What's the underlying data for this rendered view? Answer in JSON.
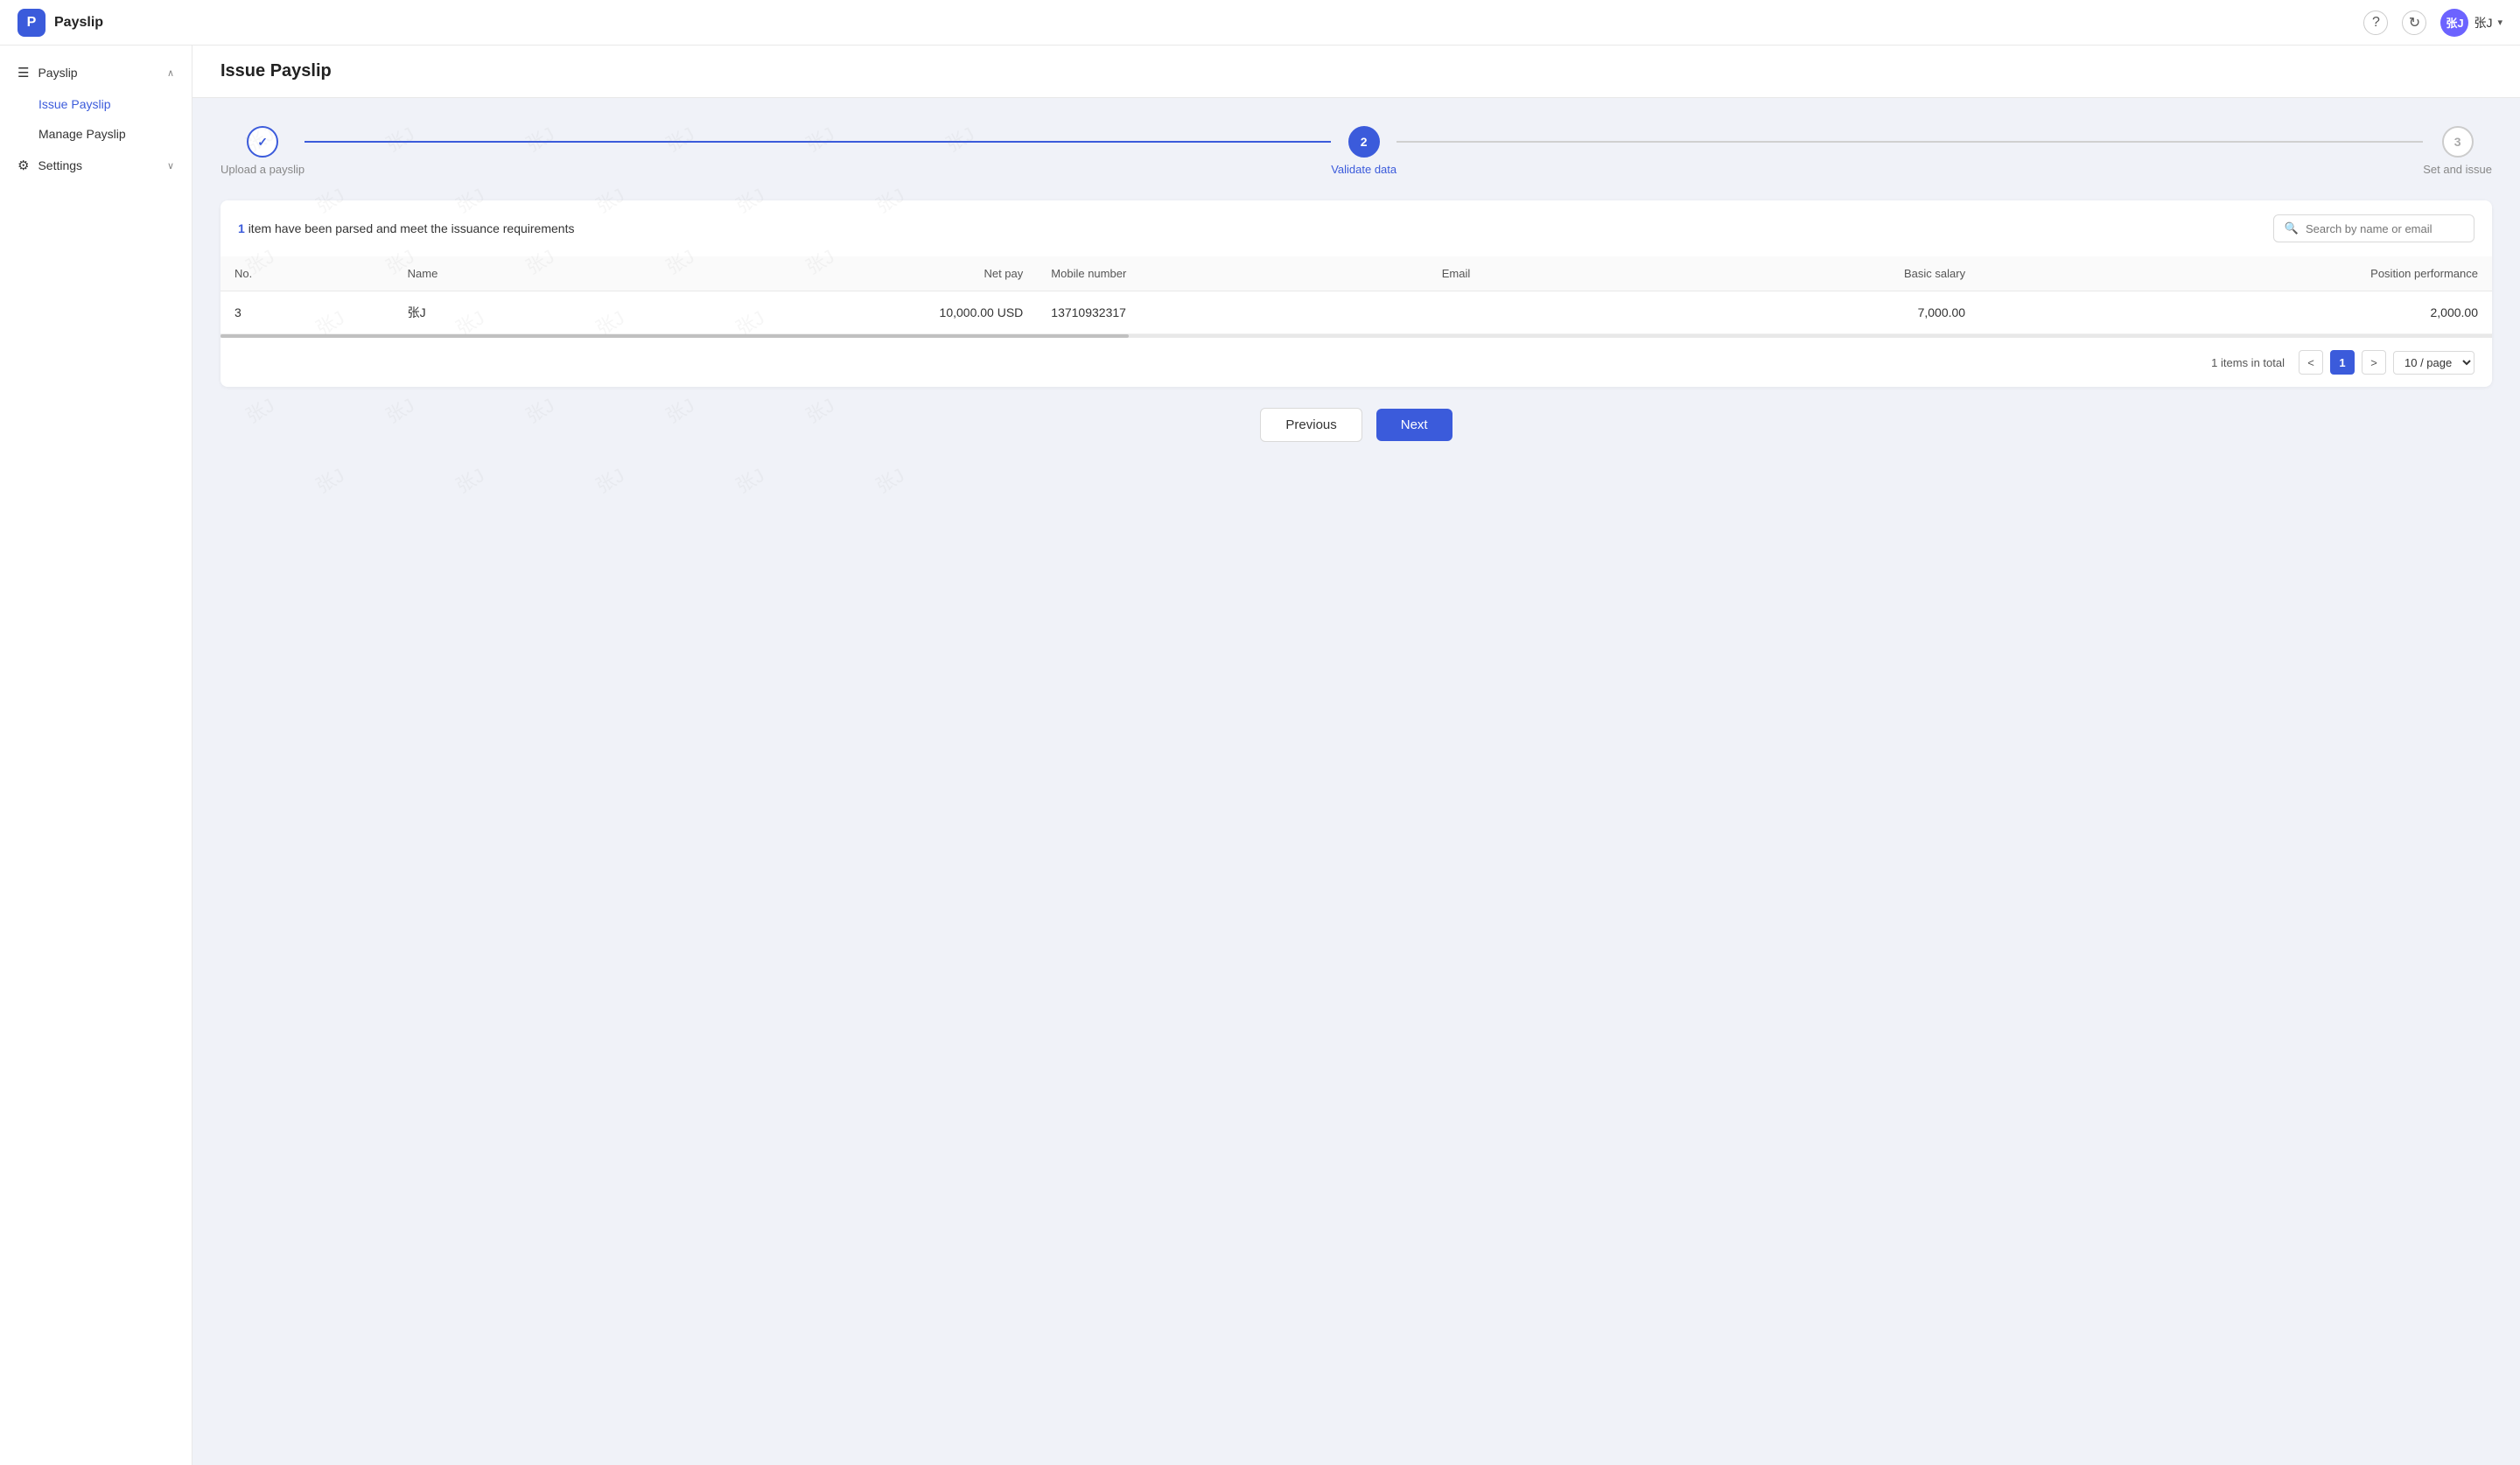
{
  "app": {
    "logo_letter": "P",
    "title": "Payslip"
  },
  "topbar": {
    "help_icon": "?",
    "refresh_icon": "↻",
    "user_avatar": "张J",
    "user_name": "张J",
    "chevron": "▾"
  },
  "sidebar": {
    "payslip_label": "Payslip",
    "issue_payslip_label": "Issue Payslip",
    "manage_payslip_label": "Manage Payslip",
    "settings_label": "Settings"
  },
  "page": {
    "title": "Issue Payslip"
  },
  "steps": [
    {
      "id": 1,
      "label": "Upload a payslip",
      "state": "done",
      "symbol": "✓"
    },
    {
      "id": 2,
      "label": "Validate data",
      "state": "active",
      "symbol": "2"
    },
    {
      "id": 3,
      "label": "Set and issue",
      "state": "pending",
      "symbol": "3"
    }
  ],
  "info": {
    "count": "1",
    "text": "item have been parsed and meet the issuance requirements",
    "search_placeholder": "Search by name or email"
  },
  "table": {
    "headers": [
      "No.",
      "Name",
      "Net pay",
      "Mobile number",
      "Email",
      "Basic salary",
      "Position performance"
    ],
    "rows": [
      {
        "no": "3",
        "name": "张J",
        "net_pay": "10,000.00 USD",
        "mobile": "13710932317",
        "email": "",
        "basic_salary": "7,000.00",
        "position_performance": "2,000.00"
      }
    ]
  },
  "pagination": {
    "total_text": "1 items in total",
    "current_page": "1",
    "per_page": "10 / page"
  },
  "buttons": {
    "previous": "Previous",
    "next": "Next"
  },
  "watermarks": [
    "张J",
    "张J",
    "张J",
    "张J",
    "张J",
    "张J",
    "张J",
    "张J",
    "张J",
    "张J",
    "张J",
    "张J",
    "张J",
    "张J",
    "张J",
    "张J",
    "张J",
    "张J",
    "张J",
    "张J",
    "张J",
    "张J",
    "张J",
    "张J",
    "张J",
    "张J",
    "张J",
    "张J",
    "张J",
    "张J"
  ]
}
